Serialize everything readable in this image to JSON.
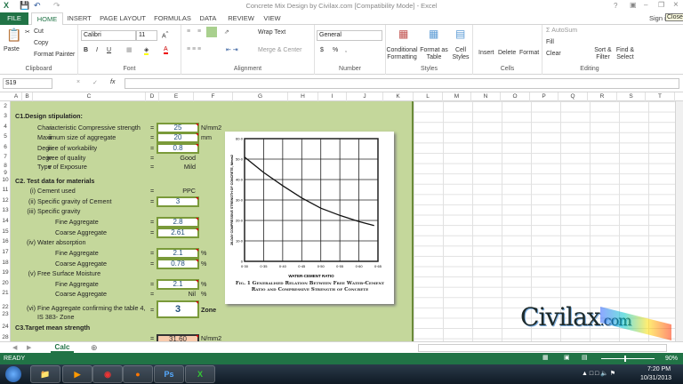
{
  "window": {
    "title": "Concrete Mix Design by Civilax.com  [Compatibility Mode] - Excel",
    "sign_in": "Sign in",
    "tooltip": "Close",
    "help": "?"
  },
  "tabs": [
    "FILE",
    "HOME",
    "INSERT",
    "PAGE LAYOUT",
    "FORMULAS",
    "DATA",
    "REVIEW",
    "VIEW"
  ],
  "ribbon": {
    "clipboard": {
      "paste": "Paste",
      "cut": "Cut",
      "copy": "Copy",
      "format_painter": "Format Painter",
      "label": "Clipboard"
    },
    "font": {
      "name": "Calibri",
      "size": "11",
      "bold": "B",
      "italic": "I",
      "underline": "U",
      "label": "Font"
    },
    "alignment": {
      "wrap": "Wrap Text",
      "merge": "Merge & Center",
      "label": "Alignment"
    },
    "number": {
      "format": "General",
      "currency": "$",
      "percent": "%",
      "comma": ",",
      "label": "Number"
    },
    "styles": {
      "conditional": "Conditional Formatting",
      "format_table": "Format as Table",
      "cell_styles": "Cell Styles",
      "label": "Styles"
    },
    "cells": {
      "insert": "Insert",
      "delete": "Delete",
      "format": "Format",
      "label": "Cells"
    },
    "editing": {
      "autosum": "AutoSum",
      "fill": "Fill",
      "clear": "Clear",
      "sort": "Sort & Filter",
      "find": "Find & Select",
      "label": "Editing"
    }
  },
  "formula_bar": {
    "name_box": "S19",
    "fx": "fx",
    "value": ""
  },
  "columns": [
    "A",
    "B",
    "C",
    "D",
    "E",
    "F",
    "G",
    "H",
    "I",
    "J",
    "K",
    "L",
    "M",
    "N",
    "O",
    "P",
    "Q",
    "R",
    "S",
    "T"
  ],
  "rows": [
    "2",
    "3",
    "4",
    "5",
    "6",
    "7",
    "8",
    "9",
    "10",
    "11",
    "12",
    "13",
    "14",
    "15",
    "16",
    "17",
    "18",
    "19",
    "20",
    "21",
    "22",
    "23",
    "24",
    "28"
  ],
  "sheet": {
    "c1": "C1.Design stipulation:",
    "r4": {
      "n": "i",
      "label": "Characteristic Compressive strength",
      "eq": "=",
      "value": "25",
      "unit": "N/mm2"
    },
    "r5": {
      "n": "ii",
      "label": "Maximum size of aggregate",
      "eq": "=",
      "value": "20",
      "unit": "mm"
    },
    "r6": {
      "n": "iii",
      "label": "Degree of workability",
      "eq": "=",
      "value": "0.8"
    },
    "r7": {
      "n": "iv",
      "label": "Degree of quality",
      "eq": "=",
      "value": "Good"
    },
    "r8": {
      "n": "v",
      "label": "Type of Exposure",
      "eq": "=",
      "value": "Mild"
    },
    "c2": "C2. Test data for materials",
    "r11": {
      "n": "(i)",
      "label": "Cement used",
      "eq": "=",
      "value": "PPC"
    },
    "r12": {
      "n": "(ii)",
      "label": "Specific gravity of Cement",
      "eq": "=",
      "value": "3"
    },
    "r13": {
      "n": "(iii)",
      "label": "Specific gravity"
    },
    "r14": {
      "label": "Fine Aggregate",
      "eq": "=",
      "value": "2.8"
    },
    "r15": {
      "label": "Coarse Aggregate",
      "eq": "=",
      "value": "2.61"
    },
    "r16": {
      "n": "(iv)",
      "label": "Water absorption"
    },
    "r17": {
      "label": "Fine Aggregate",
      "eq": "=",
      "value": "2.1",
      "unit": "%"
    },
    "r18": {
      "label": "Coarse Aggregate",
      "eq": "=",
      "value": "0.78",
      "unit": "%"
    },
    "r19": {
      "n": "(v)",
      "label": "Free Surface Moisture"
    },
    "r20": {
      "label": "Fine Aggregate",
      "eq": "=",
      "value": "2.1",
      "unit": "%"
    },
    "r21": {
      "label": "Coarse Aggregate",
      "eq": "=",
      "value": "Nil",
      "unit": "%"
    },
    "r22": {
      "n": "(vi)",
      "label": "Fine Aggregate confirming the table 4,",
      "label2": "IS 383- Zone",
      "eq": "=",
      "value": "3",
      "unit": "Zone"
    },
    "c3": "C3.Target mean strength",
    "r28": {
      "eq": "=",
      "value": "31.60",
      "unit": "N/mm2"
    }
  },
  "chart_data": {
    "type": "line",
    "title": "Fig. 1  Generalised Relation Between Free Water-Cement Ratio and Compressive Strength of Concrete",
    "xlabel": "WATER-CEMENT RATIO",
    "ylabel": "28-DAY COMPRESSIVE STRENGTH OF CONCRETE, N/mm2",
    "xlim": [
      0.3,
      0.65
    ],
    "ylim": [
      0,
      60
    ],
    "xticks": [
      "0·30",
      "0·35",
      "0·40",
      "0·45",
      "0·50",
      "0·55",
      "0·60",
      "0·65"
    ],
    "yticks": [
      "0",
      "10·0",
      "20·0",
      "30·0",
      "40·0",
      "50·0",
      "60·0"
    ],
    "x": [
      0.3,
      0.35,
      0.4,
      0.45,
      0.5,
      0.55,
      0.6,
      0.64
    ],
    "y": [
      51,
      43.5,
      37,
      31,
      26,
      22.5,
      19.5,
      17.5
    ]
  },
  "logo": "Civilax.com",
  "sheet_tabs": [
    "Calc"
  ],
  "status": {
    "text": "READY",
    "zoom": "90%"
  },
  "taskbar": {
    "time": "7:20 PM",
    "date": "10/31/2013",
    "apps": [
      "explorer",
      "media",
      "chrome",
      "firefox",
      "Ps",
      "X"
    ]
  }
}
